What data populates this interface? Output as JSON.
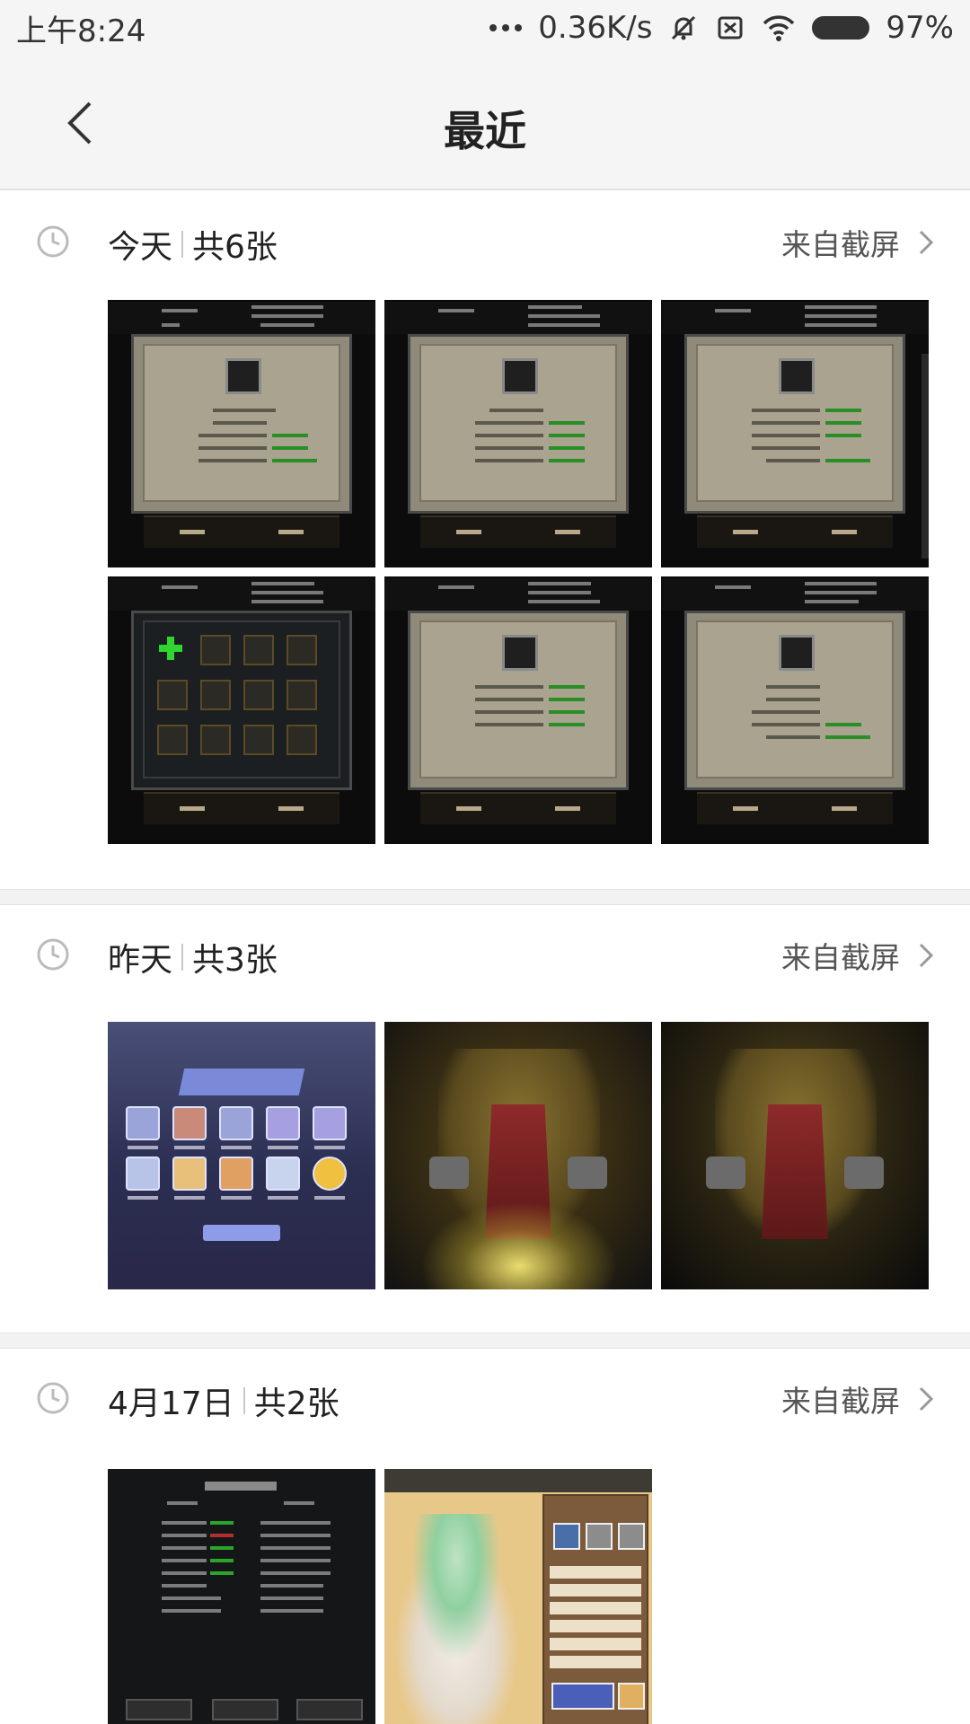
{
  "status_bar": {
    "time": "上午8:24",
    "network_speed": "0.36K/s",
    "battery": "97%"
  },
  "header": {
    "title": "最近",
    "back_icon": "chevron-left-icon"
  },
  "sections": [
    {
      "date": "今天",
      "count": "共6张",
      "source": "来自截屏",
      "thumb_count": 6
    },
    {
      "date": "昨天",
      "count": "共3张",
      "source": "来自截屏",
      "thumb_count": 3
    },
    {
      "date": "4月17日",
      "count": "共2张",
      "source": "来自截屏",
      "thumb_count": 2
    }
  ],
  "colors": {
    "header_bg": "#f5f5f5",
    "divider": "#f2f2f2",
    "text_primary": "#222222",
    "text_secondary": "#555555"
  }
}
